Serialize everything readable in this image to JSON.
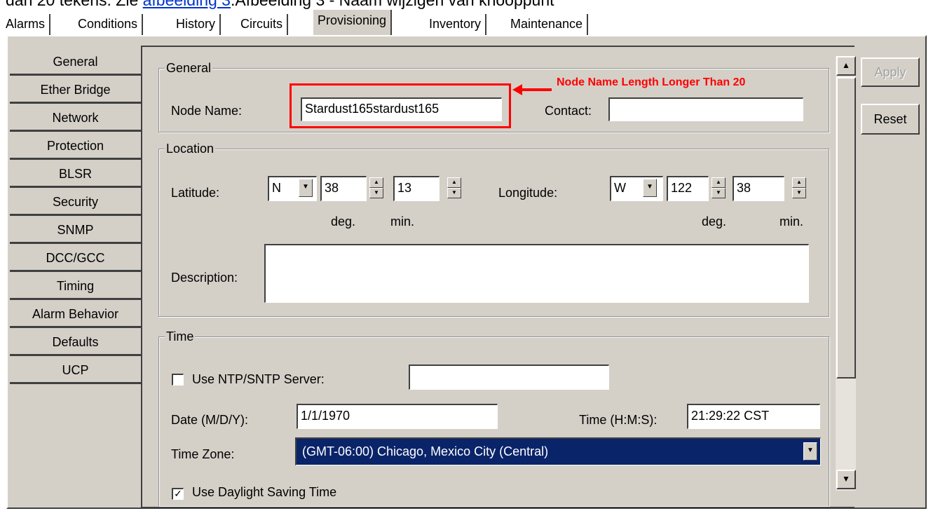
{
  "caption": {
    "prefix": "dan 20 tekens. Zie ",
    "link": "afbeelding 3",
    "suffix": ".Afbeelding 3 - Naam wijzigen van knooppunt"
  },
  "top_tabs": [
    "Alarms",
    "Conditions",
    "History",
    "Circuits",
    "Provisioning",
    "Inventory",
    "Maintenance"
  ],
  "active_tab": "Provisioning",
  "side_tabs": [
    "General",
    "Ether Bridge",
    "Network",
    "Protection",
    "BLSR",
    "Security",
    "SNMP",
    "DCC/GCC",
    "Timing",
    "Alarm Behavior",
    "Defaults",
    "UCP"
  ],
  "general": {
    "legend": "General",
    "node_name_label": "Node Name:",
    "node_name_value": "Stardust165stardust165",
    "contact_label": "Contact:",
    "contact_value": "",
    "annotation": "Node Name Length Longer Than 20"
  },
  "location": {
    "legend": "Location",
    "latitude_label": "Latitude:",
    "lat_dir": "N",
    "lat_deg": "38",
    "lat_min": "13",
    "longitude_label": "Longitude:",
    "lon_dir": "W",
    "lon_deg": "122",
    "lon_min": "38",
    "deg_label": "deg.",
    "min_label": "min.",
    "description_label": "Description:",
    "description_value": ""
  },
  "time": {
    "legend": "Time",
    "ntp_label": "Use NTP/SNTP Server:",
    "ntp_checked": false,
    "ntp_value": "",
    "date_label": "Date (M/D/Y):",
    "date_value": "1/1/1970",
    "time_label": "Time (H:M:S):",
    "time_value": "21:29:22 CST",
    "zone_label": "Time Zone:",
    "zone_value": "(GMT-06:00) Chicago, Mexico City (Central)",
    "dst_label": "Use Daylight Saving Time",
    "dst_checked": true
  },
  "buttons": {
    "apply": "Apply",
    "reset": "Reset"
  },
  "colors": {
    "panel": "#d4d0c8",
    "annotation": "#ff0000",
    "selection": "#0a246a"
  }
}
